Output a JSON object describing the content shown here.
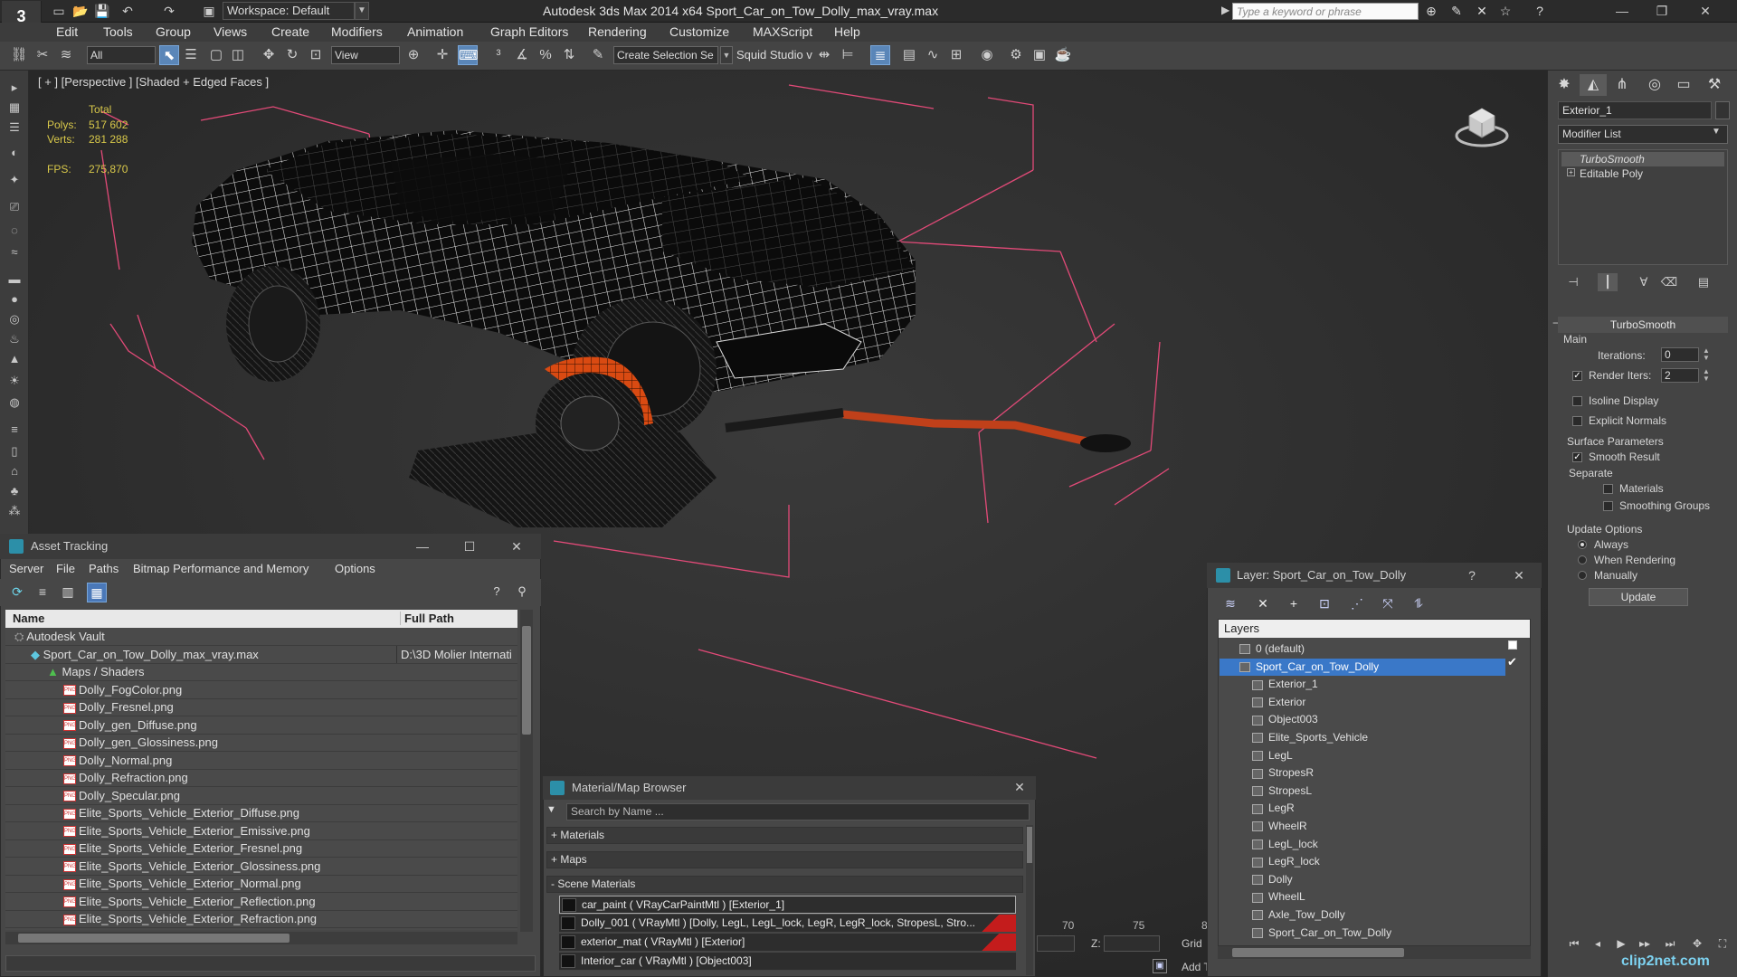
{
  "app": {
    "logo_text": "3",
    "title": "Autodesk 3ds Max  2014 x64      Sport_Car_on_Tow_Dolly_max_vray.max",
    "workspace": "Workspace: Default",
    "search_placeholder": "Type a keyword or phrase"
  },
  "menu": [
    "Edit",
    "Tools",
    "Group",
    "Views",
    "Create",
    "Modifiers",
    "Animation",
    "Graph Editors",
    "Rendering",
    "Customize",
    "MAXScript",
    "Help"
  ],
  "toolbar": {
    "selection_filter": "All",
    "ref_coord": "View",
    "named_selection_placeholder": "Create Selection Se",
    "studio_label": "Squid Studio v"
  },
  "viewport": {
    "label": "[ + ] [Perspective ] [Shaded + Edged Faces ]",
    "stats": {
      "total_label": "Total",
      "polys_label": "Polys:",
      "polys": "517 602",
      "verts_label": "Verts:",
      "verts": "281 288",
      "fps_label": "FPS:",
      "fps": "275,870"
    }
  },
  "command_panel": {
    "object_name": "Exterior_1",
    "modifier_list": "Modifier List",
    "stack": [
      "TurboSmooth",
      "Editable Poly"
    ],
    "turbosmooth": {
      "title": "TurboSmooth",
      "main": "Main",
      "iterations_label": "Iterations:",
      "iterations": "0",
      "render_iters_label": "Render Iters:",
      "render_iters": "2",
      "isoline": "Isoline Display",
      "explicit_normals": "Explicit Normals",
      "surface_params": "Surface Parameters",
      "smooth_result": "Smooth Result",
      "separate": "Separate",
      "materials": "Materials",
      "smoothing_groups": "Smoothing Groups",
      "update_options": "Update Options",
      "always": "Always",
      "when_rendering": "When Rendering",
      "manually": "Manually",
      "update_button": "Update"
    }
  },
  "timeline": {
    "ticks": [
      "70",
      "75",
      "8"
    ],
    "z_label": "Z:",
    "grid_label": "Grid",
    "add_label": "Add T"
  },
  "asset_tracking": {
    "title": "Asset Tracking",
    "menu": [
      "Server",
      "File",
      "Paths",
      "Bitmap Performance and Memory",
      "Options"
    ],
    "columns": [
      "Name",
      "Full Path"
    ],
    "rows": [
      {
        "name": "Autodesk Vault",
        "path": "",
        "indent": 0,
        "type": "vault"
      },
      {
        "name": "Sport_Car_on_Tow_Dolly_max_vray.max",
        "path": "D:\\3D Molier Internati",
        "indent": 1,
        "type": "max"
      },
      {
        "name": "Maps / Shaders",
        "path": "",
        "indent": 2,
        "type": "folder"
      },
      {
        "name": "Dolly_FogColor.png",
        "path": "",
        "indent": 3,
        "type": "png"
      },
      {
        "name": "Dolly_Fresnel.png",
        "path": "",
        "indent": 3,
        "type": "png"
      },
      {
        "name": "Dolly_gen_Diffuse.png",
        "path": "",
        "indent": 3,
        "type": "png"
      },
      {
        "name": "Dolly_gen_Glossiness.png",
        "path": "",
        "indent": 3,
        "type": "png"
      },
      {
        "name": "Dolly_Normal.png",
        "path": "",
        "indent": 3,
        "type": "png"
      },
      {
        "name": "Dolly_Refraction.png",
        "path": "",
        "indent": 3,
        "type": "png"
      },
      {
        "name": "Dolly_Specular.png",
        "path": "",
        "indent": 3,
        "type": "png"
      },
      {
        "name": "Elite_Sports_Vehicle_Exterior_Diffuse.png",
        "path": "",
        "indent": 3,
        "type": "png"
      },
      {
        "name": "Elite_Sports_Vehicle_Exterior_Emissive.png",
        "path": "",
        "indent": 3,
        "type": "png"
      },
      {
        "name": "Elite_Sports_Vehicle_Exterior_Fresnel.png",
        "path": "",
        "indent": 3,
        "type": "png"
      },
      {
        "name": "Elite_Sports_Vehicle_Exterior_Glossiness.png",
        "path": "",
        "indent": 3,
        "type": "png"
      },
      {
        "name": "Elite_Sports_Vehicle_Exterior_Normal.png",
        "path": "",
        "indent": 3,
        "type": "png"
      },
      {
        "name": "Elite_Sports_Vehicle_Exterior_Reflection.png",
        "path": "",
        "indent": 3,
        "type": "png"
      },
      {
        "name": "Elite_Sports_Vehicle_Exterior_Refraction.png",
        "path": "",
        "indent": 3,
        "type": "png"
      }
    ]
  },
  "material_browser": {
    "title": "Material/Map Browser",
    "search_placeholder": "Search by Name ...",
    "groups": [
      "+ Materials",
      "+ Maps",
      "- Scene Materials"
    ],
    "materials": [
      {
        "label": "car_paint  ( VRayCarPaintMtl )  [Exterior_1]",
        "red": false,
        "selected": true
      },
      {
        "label": "Dolly_001  ( VRayMtl )  [Dolly, LegL, LegL_lock, LegR, LegR_lock, StropesL, Stro...",
        "red": true,
        "selected": false
      },
      {
        "label": "exterior_mat  ( VRayMtl )  [Exterior]",
        "red": true,
        "selected": false
      },
      {
        "label": "Interior_car  ( VRayMtl )  [Object003]",
        "red": false,
        "selected": false
      }
    ]
  },
  "layer_window": {
    "title": "Layer: Sport_Car_on_Tow_Dolly",
    "header": "Layers",
    "rows": [
      {
        "name": "0 (default)",
        "indent": 1,
        "selected": false
      },
      {
        "name": "Sport_Car_on_Tow_Dolly",
        "indent": 1,
        "selected": true
      },
      {
        "name": "Exterior_1",
        "indent": 2,
        "selected": false
      },
      {
        "name": "Exterior",
        "indent": 2,
        "selected": false
      },
      {
        "name": "Object003",
        "indent": 2,
        "selected": false
      },
      {
        "name": "Elite_Sports_Vehicle",
        "indent": 2,
        "selected": false
      },
      {
        "name": "LegL",
        "indent": 2,
        "selected": false
      },
      {
        "name": "StropesR",
        "indent": 2,
        "selected": false
      },
      {
        "name": "StropesL",
        "indent": 2,
        "selected": false
      },
      {
        "name": "LegR",
        "indent": 2,
        "selected": false
      },
      {
        "name": "WheelR",
        "indent": 2,
        "selected": false
      },
      {
        "name": "LegL_lock",
        "indent": 2,
        "selected": false
      },
      {
        "name": "LegR_lock",
        "indent": 2,
        "selected": false
      },
      {
        "name": "Dolly",
        "indent": 2,
        "selected": false
      },
      {
        "name": "WheelL",
        "indent": 2,
        "selected": false
      },
      {
        "name": "Axle_Tow_Dolly",
        "indent": 2,
        "selected": false
      },
      {
        "name": "Sport_Car_on_Tow_Dolly",
        "indent": 2,
        "selected": false
      }
    ]
  },
  "watermark": "clip2net.com",
  "colors": {
    "selection_blue": "#3a78c8",
    "stat_yellow": "#d8c84a",
    "wire_white": "#f2f2f2",
    "bbox_pink": "#e8507a",
    "dolly_orange": "#e0501a"
  }
}
